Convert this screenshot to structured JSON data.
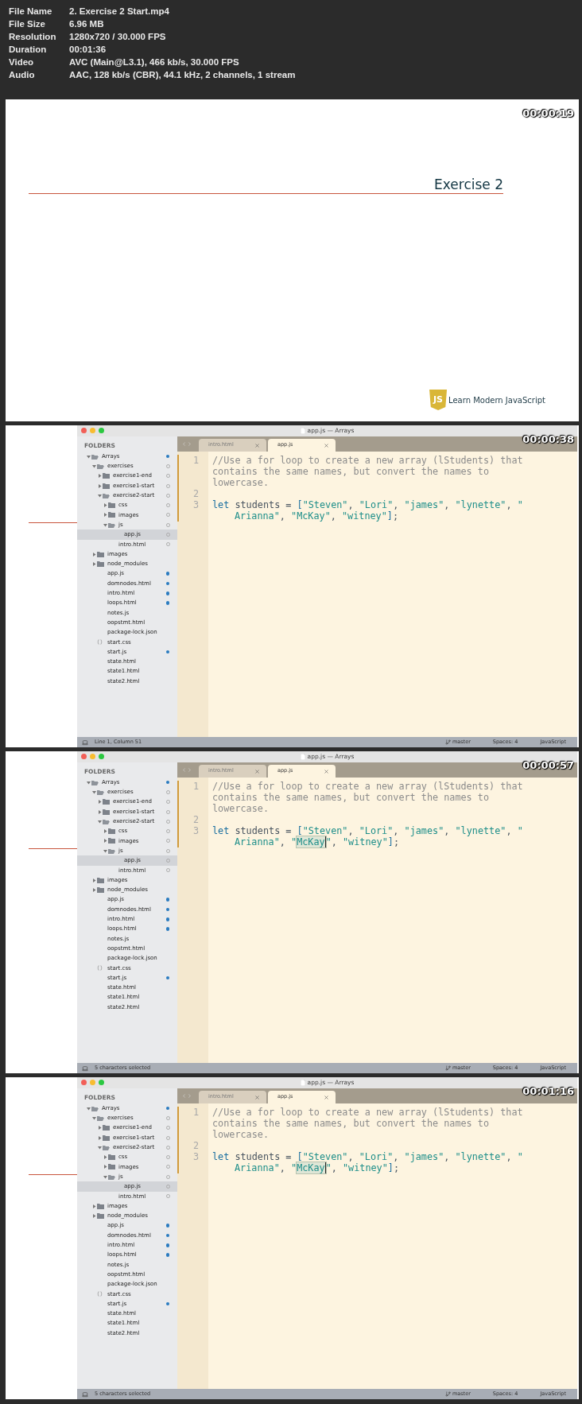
{
  "info": {
    "fields": [
      {
        "label": "File Name",
        "value": "2. Exercise 2 Start.mp4"
      },
      {
        "label": "File Size",
        "value": "6.96 MB"
      },
      {
        "label": "Resolution",
        "value": "1280x720 / 30.000 FPS"
      },
      {
        "label": "Duration",
        "value": "00:01:36"
      },
      {
        "label": "Video",
        "value": "AVC (Main@L3.1), 466 kb/s, 30.000 FPS"
      },
      {
        "label": "Audio",
        "value": "AAC, 128 kb/s (CBR), 44.1 kHz, 2 channels, 1 stream"
      }
    ]
  },
  "frames": [
    {
      "kind": "slide",
      "timestamp": "00:00:19",
      "title": "Exercise 2",
      "brand": {
        "logo_text": "JS",
        "name": "Learn Modern JavaScript"
      }
    },
    {
      "kind": "editor",
      "timestamp": "00:00:38",
      "window_title": "app.js — Arrays",
      "sidebar_heading": "FOLDERS",
      "tabs": [
        {
          "label": "intro.html",
          "selected": false
        },
        {
          "label": "app.js",
          "selected": true
        }
      ],
      "tree": [
        {
          "name": "Arrays",
          "kind": "folder",
          "expanded": true,
          "selected": false,
          "modified": true,
          "children": [
            {
              "name": "exercises",
              "kind": "folder",
              "expanded": true,
              "selected": false,
              "modified": false,
              "children": [
                {
                  "name": "exercise1-end",
                  "kind": "folder",
                  "expanded": false,
                  "selected": false,
                  "modified": false
                },
                {
                  "name": "exercise1-start",
                  "kind": "folder",
                  "expanded": false,
                  "selected": false,
                  "modified": false
                },
                {
                  "name": "exercise2-start",
                  "kind": "folder",
                  "expanded": true,
                  "selected": false,
                  "modified": false,
                  "children": [
                    {
                      "name": "css",
                      "kind": "folder",
                      "expanded": false,
                      "selected": false,
                      "modified": false
                    },
                    {
                      "name": "images",
                      "kind": "folder",
                      "expanded": false,
                      "selected": false,
                      "modified": false
                    },
                    {
                      "name": "js",
                      "kind": "folder",
                      "expanded": true,
                      "selected": false,
                      "modified": false,
                      "children": [
                        {
                          "name": "app.js",
                          "kind": "file",
                          "selected": true,
                          "modified": false
                        }
                      ]
                    },
                    {
                      "name": "intro.html",
                      "kind": "file",
                      "selected": false,
                      "modified": false
                    }
                  ]
                }
              ]
            },
            {
              "name": "images",
              "kind": "folder",
              "expanded": false,
              "selected": false
            },
            {
              "name": "node_modules",
              "kind": "folder",
              "expanded": false,
              "selected": false
            },
            {
              "name": "app.js",
              "kind": "file",
              "selected": false,
              "modified": true
            },
            {
              "name": "domnodes.html",
              "kind": "file",
              "selected": false,
              "modified": true
            },
            {
              "name": "intro.html",
              "kind": "file",
              "selected": false,
              "modified": true
            },
            {
              "name": "loops.html",
              "kind": "file",
              "selected": false,
              "modified": true
            },
            {
              "name": "notes.js",
              "kind": "file",
              "selected": false
            },
            {
              "name": "oopstmt.html",
              "kind": "file",
              "selected": false
            },
            {
              "name": "package-lock.json",
              "kind": "file",
              "selected": false
            },
            {
              "name": "start.css",
              "kind": "css",
              "selected": false
            },
            {
              "name": "start.js",
              "kind": "file",
              "selected": false,
              "modified": true
            },
            {
              "name": "state.html",
              "kind": "file",
              "selected": false
            },
            {
              "name": "state1.html",
              "kind": "file",
              "selected": false
            },
            {
              "name": "state2.html",
              "kind": "file",
              "selected": false
            }
          ]
        }
      ],
      "code": [
        {
          "number": "1",
          "changed": true,
          "rows": [
            {
              "indented": false,
              "tokens": [
                {
                  "kind": "comment",
                  "text": "//Use a for loop to create a new array (lStudents) that",
                  "selected": false
                }
              ]
            },
            {
              "indented": false,
              "tokens": [
                {
                  "kind": "comment",
                  "text": "contains the same names, but convert the names to",
                  "selected": false
                }
              ]
            },
            {
              "indented": false,
              "tokens": [
                {
                  "kind": "comment",
                  "text": "lowercase.",
                  "selected": false
                }
              ]
            }
          ]
        },
        {
          "number": "2",
          "changed": true
        },
        {
          "number": "3",
          "changed": true,
          "rows": [
            {
              "indented": false,
              "tokens": [
                {
                  "kind": "keyword",
                  "text": "let",
                  "selected": false
                },
                {
                  "kind": "plain",
                  "text": " students = ",
                  "selected": false
                },
                {
                  "kind": "bracket",
                  "text": "[",
                  "selected": false
                },
                {
                  "kind": "string",
                  "text": "\"Steven\"",
                  "selected": false
                },
                {
                  "kind": "plain",
                  "text": ", ",
                  "selected": false
                },
                {
                  "kind": "string",
                  "text": "\"Lori\"",
                  "selected": false
                },
                {
                  "kind": "plain",
                  "text": ", ",
                  "selected": false
                },
                {
                  "kind": "string",
                  "text": "\"james\"",
                  "selected": false
                },
                {
                  "kind": "plain",
                  "text": ", ",
                  "selected": false
                },
                {
                  "kind": "string",
                  "text": "\"lynette\"",
                  "selected": false
                },
                {
                  "kind": "plain",
                  "text": ", ",
                  "selected": false
                },
                {
                  "kind": "string",
                  "text": "\"",
                  "selected": false
                }
              ]
            },
            {
              "indented": true,
              "tokens": [
                {
                  "kind": "string",
                  "text": "Arianna\"",
                  "selected": false
                },
                {
                  "kind": "plain",
                  "text": ", ",
                  "selected": false
                },
                {
                  "kind": "string",
                  "text": "\"McKay\"",
                  "selected": false
                },
                {
                  "kind": "plain",
                  "text": ", ",
                  "selected": false
                },
                {
                  "kind": "string",
                  "text": "\"witney\"",
                  "selected": false
                },
                {
                  "kind": "bracket",
                  "text": "]",
                  "selected": false
                },
                {
                  "kind": "plain",
                  "text": ";",
                  "selected": false
                }
              ]
            }
          ]
        }
      ],
      "status": {
        "text": "Line 1, Column 51",
        "branch": "master",
        "indentation": "Spaces: 4",
        "syntax": "JavaScript"
      }
    },
    {
      "kind": "editor",
      "timestamp": "00:00:57",
      "window_title": "app.js — Arrays",
      "sidebar_heading": "FOLDERS",
      "tabs": [
        {
          "label": "intro.html",
          "selected": false
        },
        {
          "label": "app.js",
          "selected": true
        }
      ],
      "tree": [
        {
          "name": "Arrays",
          "kind": "folder",
          "expanded": true,
          "selected": false,
          "modified": true,
          "children": [
            {
              "name": "exercises",
              "kind": "folder",
              "expanded": true,
              "selected": false,
              "modified": false,
              "children": [
                {
                  "name": "exercise1-end",
                  "kind": "folder",
                  "expanded": false,
                  "selected": false,
                  "modified": false
                },
                {
                  "name": "exercise1-start",
                  "kind": "folder",
                  "expanded": false,
                  "selected": false,
                  "modified": false
                },
                {
                  "name": "exercise2-start",
                  "kind": "folder",
                  "expanded": true,
                  "selected": false,
                  "modified": false,
                  "children": [
                    {
                      "name": "css",
                      "kind": "folder",
                      "expanded": false,
                      "selected": false,
                      "modified": false
                    },
                    {
                      "name": "images",
                      "kind": "folder",
                      "expanded": false,
                      "selected": false,
                      "modified": false
                    },
                    {
                      "name": "js",
                      "kind": "folder",
                      "expanded": true,
                      "selected": false,
                      "modified": false,
                      "children": [
                        {
                          "name": "app.js",
                          "kind": "file",
                          "selected": true,
                          "modified": false
                        }
                      ]
                    },
                    {
                      "name": "intro.html",
                      "kind": "file",
                      "selected": false,
                      "modified": false
                    }
                  ]
                }
              ]
            },
            {
              "name": "images",
              "kind": "folder",
              "expanded": false,
              "selected": false
            },
            {
              "name": "node_modules",
              "kind": "folder",
              "expanded": false,
              "selected": false
            },
            {
              "name": "app.js",
              "kind": "file",
              "selected": false,
              "modified": true
            },
            {
              "name": "domnodes.html",
              "kind": "file",
              "selected": false,
              "modified": true
            },
            {
              "name": "intro.html",
              "kind": "file",
              "selected": false,
              "modified": true
            },
            {
              "name": "loops.html",
              "kind": "file",
              "selected": false,
              "modified": true
            },
            {
              "name": "notes.js",
              "kind": "file",
              "selected": false
            },
            {
              "name": "oopstmt.html",
              "kind": "file",
              "selected": false
            },
            {
              "name": "package-lock.json",
              "kind": "file",
              "selected": false
            },
            {
              "name": "start.css",
              "kind": "css",
              "selected": false
            },
            {
              "name": "start.js",
              "kind": "file",
              "selected": false,
              "modified": true
            },
            {
              "name": "state.html",
              "kind": "file",
              "selected": false
            },
            {
              "name": "state1.html",
              "kind": "file",
              "selected": false
            },
            {
              "name": "state2.html",
              "kind": "file",
              "selected": false
            }
          ]
        }
      ],
      "code": [
        {
          "number": "1",
          "changed": true,
          "rows": [
            {
              "indented": false,
              "tokens": [
                {
                  "kind": "comment",
                  "text": "//Use a for loop to create a new array (lStudents) that",
                  "selected": false
                }
              ]
            },
            {
              "indented": false,
              "tokens": [
                {
                  "kind": "comment",
                  "text": "contains the same names, but convert the names to",
                  "selected": false
                }
              ]
            },
            {
              "indented": false,
              "tokens": [
                {
                  "kind": "comment",
                  "text": "lowercase.",
                  "selected": false
                }
              ]
            }
          ]
        },
        {
          "number": "2",
          "changed": true
        },
        {
          "number": "3",
          "changed": true,
          "rows": [
            {
              "indented": false,
              "tokens": [
                {
                  "kind": "keyword",
                  "text": "let",
                  "selected": false
                },
                {
                  "kind": "plain",
                  "text": " students = ",
                  "selected": false
                },
                {
                  "kind": "bracket",
                  "text": "[",
                  "selected": false
                },
                {
                  "kind": "string",
                  "text": "\"Steven\"",
                  "selected": false
                },
                {
                  "kind": "plain",
                  "text": ", ",
                  "selected": false
                },
                {
                  "kind": "string",
                  "text": "\"Lori\"",
                  "selected": false
                },
                {
                  "kind": "plain",
                  "text": ", ",
                  "selected": false
                },
                {
                  "kind": "string",
                  "text": "\"james\"",
                  "selected": false
                },
                {
                  "kind": "plain",
                  "text": ", ",
                  "selected": false
                },
                {
                  "kind": "string",
                  "text": "\"lynette\"",
                  "selected": false
                },
                {
                  "kind": "plain",
                  "text": ", ",
                  "selected": false
                },
                {
                  "kind": "string",
                  "text": "\"",
                  "selected": false
                }
              ]
            },
            {
              "indented": true,
              "tokens": [
                {
                  "kind": "string",
                  "text": "Arianna\"",
                  "selected": false
                },
                {
                  "kind": "plain",
                  "text": ", ",
                  "selected": false
                },
                {
                  "kind": "string",
                  "text": "\"",
                  "selected": false
                },
                {
                  "kind": "string",
                  "text": "McKay",
                  "selected": true
                },
                {
                  "kind": "string",
                  "text": "\"",
                  "selected": false
                },
                {
                  "kind": "plain",
                  "text": ", ",
                  "selected": false
                },
                {
                  "kind": "string",
                  "text": "\"witney\"",
                  "selected": false
                },
                {
                  "kind": "bracket",
                  "text": "]",
                  "selected": false
                },
                {
                  "kind": "plain",
                  "text": ";",
                  "selected": false
                }
              ]
            }
          ]
        }
      ],
      "status": {
        "text": "5 characters selected",
        "branch": "master",
        "indentation": "Spaces: 4",
        "syntax": "JavaScript"
      }
    },
    {
      "kind": "editor",
      "timestamp": "00:01:16",
      "window_title": "app.js — Arrays",
      "sidebar_heading": "FOLDERS",
      "tabs": [
        {
          "label": "intro.html",
          "selected": false
        },
        {
          "label": "app.js",
          "selected": true
        }
      ],
      "tree": [
        {
          "name": "Arrays",
          "kind": "folder",
          "expanded": true,
          "selected": false,
          "modified": true,
          "children": [
            {
              "name": "exercises",
              "kind": "folder",
              "expanded": true,
              "selected": false,
              "modified": false,
              "children": [
                {
                  "name": "exercise1-end",
                  "kind": "folder",
                  "expanded": false,
                  "selected": false,
                  "modified": false
                },
                {
                  "name": "exercise1-start",
                  "kind": "folder",
                  "expanded": false,
                  "selected": false,
                  "modified": false
                },
                {
                  "name": "exercise2-start",
                  "kind": "folder",
                  "expanded": true,
                  "selected": false,
                  "modified": false,
                  "children": [
                    {
                      "name": "css",
                      "kind": "folder",
                      "expanded": false,
                      "selected": false,
                      "modified": false
                    },
                    {
                      "name": "images",
                      "kind": "folder",
                      "expanded": false,
                      "selected": false,
                      "modified": false
                    },
                    {
                      "name": "js",
                      "kind": "folder",
                      "expanded": true,
                      "selected": false,
                      "modified": false,
                      "children": [
                        {
                          "name": "app.js",
                          "kind": "file",
                          "selected": true,
                          "modified": false
                        }
                      ]
                    },
                    {
                      "name": "intro.html",
                      "kind": "file",
                      "selected": false,
                      "modified": false
                    }
                  ]
                }
              ]
            },
            {
              "name": "images",
              "kind": "folder",
              "expanded": false,
              "selected": false
            },
            {
              "name": "node_modules",
              "kind": "folder",
              "expanded": false,
              "selected": false
            },
            {
              "name": "app.js",
              "kind": "file",
              "selected": false,
              "modified": true
            },
            {
              "name": "domnodes.html",
              "kind": "file",
              "selected": false,
              "modified": true
            },
            {
              "name": "intro.html",
              "kind": "file",
              "selected": false,
              "modified": true
            },
            {
              "name": "loops.html",
              "kind": "file",
              "selected": false,
              "modified": true
            },
            {
              "name": "notes.js",
              "kind": "file",
              "selected": false
            },
            {
              "name": "oopstmt.html",
              "kind": "file",
              "selected": false
            },
            {
              "name": "package-lock.json",
              "kind": "file",
              "selected": false
            },
            {
              "name": "start.css",
              "kind": "css",
              "selected": false
            },
            {
              "name": "start.js",
              "kind": "file",
              "selected": false,
              "modified": true
            },
            {
              "name": "state.html",
              "kind": "file",
              "selected": false
            },
            {
              "name": "state1.html",
              "kind": "file",
              "selected": false
            },
            {
              "name": "state2.html",
              "kind": "file",
              "selected": false
            }
          ]
        }
      ],
      "code": [
        {
          "number": "1",
          "changed": true,
          "rows": [
            {
              "indented": false,
              "tokens": [
                {
                  "kind": "comment",
                  "text": "//Use a for loop to create a new array (lStudents) that",
                  "selected": false
                }
              ]
            },
            {
              "indented": false,
              "tokens": [
                {
                  "kind": "comment",
                  "text": "contains the same names, but convert the names to",
                  "selected": false
                }
              ]
            },
            {
              "indented": false,
              "tokens": [
                {
                  "kind": "comment",
                  "text": "lowercase.",
                  "selected": false
                }
              ]
            }
          ]
        },
        {
          "number": "2",
          "changed": true
        },
        {
          "number": "3",
          "changed": true,
          "rows": [
            {
              "indented": false,
              "tokens": [
                {
                  "kind": "keyword",
                  "text": "let",
                  "selected": false
                },
                {
                  "kind": "plain",
                  "text": " students = ",
                  "selected": false
                },
                {
                  "kind": "bracket",
                  "text": "[",
                  "selected": false
                },
                {
                  "kind": "string",
                  "text": "\"Steven\"",
                  "selected": false
                },
                {
                  "kind": "plain",
                  "text": ", ",
                  "selected": false
                },
                {
                  "kind": "string",
                  "text": "\"Lori\"",
                  "selected": false
                },
                {
                  "kind": "plain",
                  "text": ", ",
                  "selected": false
                },
                {
                  "kind": "string",
                  "text": "\"james\"",
                  "selected": false
                },
                {
                  "kind": "plain",
                  "text": ", ",
                  "selected": false
                },
                {
                  "kind": "string",
                  "text": "\"lynette\"",
                  "selected": false
                },
                {
                  "kind": "plain",
                  "text": ", ",
                  "selected": false
                },
                {
                  "kind": "string",
                  "text": "\"",
                  "selected": false
                }
              ]
            },
            {
              "indented": true,
              "tokens": [
                {
                  "kind": "string",
                  "text": "Arianna\"",
                  "selected": false
                },
                {
                  "kind": "plain",
                  "text": ", ",
                  "selected": false
                },
                {
                  "kind": "string",
                  "text": "\"",
                  "selected": false
                },
                {
                  "kind": "string",
                  "text": "McKay",
                  "selected": true
                },
                {
                  "kind": "string",
                  "text": "\"",
                  "selected": false
                },
                {
                  "kind": "plain",
                  "text": ", ",
                  "selected": false
                },
                {
                  "kind": "string",
                  "text": "\"witney\"",
                  "selected": false
                },
                {
                  "kind": "bracket",
                  "text": "]",
                  "selected": false
                },
                {
                  "kind": "plain",
                  "text": ";",
                  "selected": false
                }
              ]
            }
          ]
        }
      ],
      "status": {
        "text": "5 characters selected",
        "branch": "master",
        "indentation": "Spaces: 4",
        "syntax": "JavaScript"
      }
    }
  ]
}
